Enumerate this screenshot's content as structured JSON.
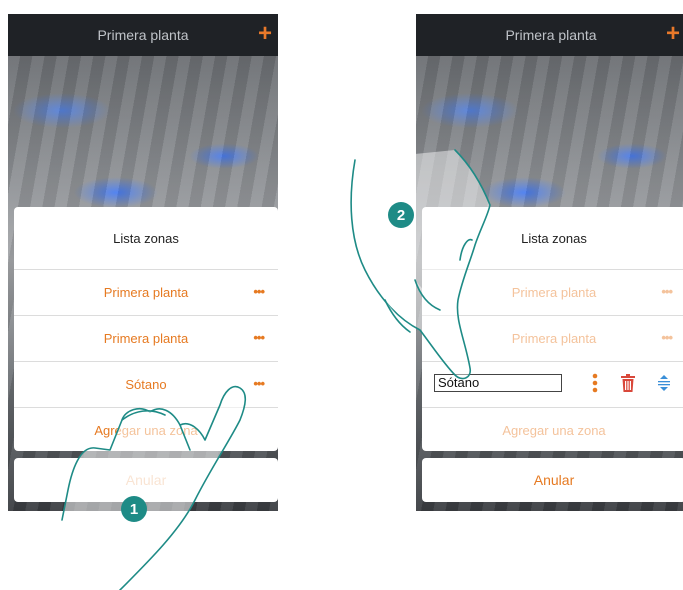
{
  "phone_left": {
    "header_title": "Primera planta",
    "plus_label": "+",
    "dialog_title": "Lista zonas",
    "rows": [
      {
        "label": "Primera planta",
        "dots": "•••"
      },
      {
        "label": "Primera planta",
        "dots": "•••"
      },
      {
        "label": "Sótano",
        "dots": "•••"
      }
    ],
    "add_zone": "Agregar una zona",
    "cancel": "Anular",
    "step": "1"
  },
  "phone_right": {
    "header_title": "Primera planta",
    "plus_label": "+",
    "dialog_title": "Lista zonas",
    "rows": [
      {
        "label": "Primera planta",
        "dots": "•••"
      },
      {
        "label": "Primera planta",
        "dots": "•••"
      }
    ],
    "edit_value": "Sótano",
    "menu_dots": "⋮",
    "add_zone": "Agregar una zona",
    "cancel": "Anular",
    "step": "2"
  },
  "colors": {
    "accent": "#e67a22",
    "header_bg": "#1f2226",
    "step_badge": "#1e8b86",
    "hand_outline": "#1e8b86"
  },
  "icons": [
    "plus-icon",
    "more-dots-icon",
    "trash-icon",
    "reorder-icon",
    "vertical-dots-icon",
    "hand-pointer-icon"
  ]
}
